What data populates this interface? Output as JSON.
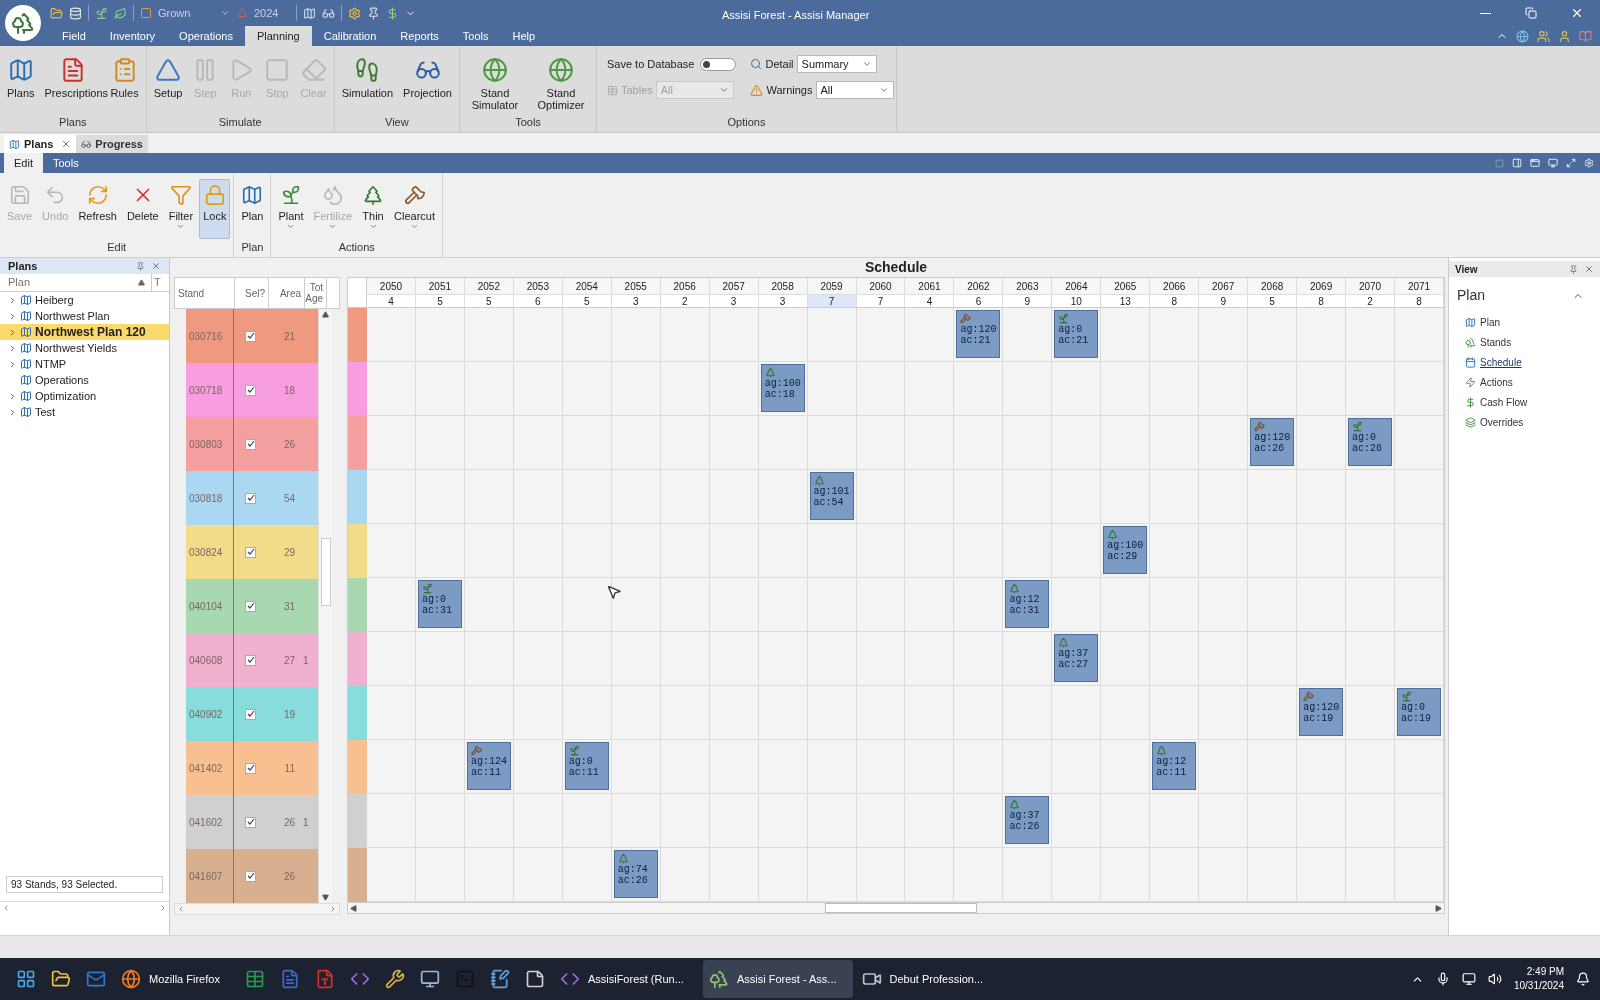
{
  "window": {
    "title": "Assisi Forest - Assisi Manager"
  },
  "quick_access": {
    "mode": "Grown",
    "year": "2024"
  },
  "menu_tabs": [
    {
      "label": "Field",
      "selected": false
    },
    {
      "label": "Inventory",
      "selected": false
    },
    {
      "label": "Operations",
      "selected": false
    },
    {
      "label": "Planning",
      "selected": true
    },
    {
      "label": "Calibration",
      "selected": false
    },
    {
      "label": "Reports",
      "selected": false
    },
    {
      "label": "Tools",
      "selected": false
    },
    {
      "label": "Help",
      "selected": false
    }
  ],
  "ribbon": [
    {
      "label": "Plans",
      "buttons": [
        {
          "kind": "plans",
          "label": "Plans",
          "disabled": false
        },
        {
          "kind": "prescriptions",
          "label": "Prescriptions",
          "disabled": false
        },
        {
          "kind": "rules",
          "label": "Rules",
          "disabled": false
        }
      ]
    },
    {
      "label": "Simulate",
      "buttons": [
        {
          "kind": "setup",
          "label": "Setup",
          "disabled": false
        },
        {
          "kind": "step",
          "label": "Step",
          "disabled": true
        },
        {
          "kind": "run",
          "label": "Run",
          "disabled": true
        },
        {
          "kind": "stop",
          "label": "Stop",
          "disabled": true
        },
        {
          "kind": "clear",
          "label": "Clear",
          "disabled": true
        }
      ]
    },
    {
      "label": "View",
      "buttons": [
        {
          "kind": "simulation",
          "label": "Simulation",
          "disabled": false
        },
        {
          "kind": "projection",
          "label": "Projection",
          "disabled": false
        }
      ]
    },
    {
      "label": "Tools",
      "buttons": [
        {
          "kind": "simulator",
          "label": "Stand Simulator",
          "disabled": false
        },
        {
          "kind": "optimizer",
          "label": "Stand Optimizer",
          "disabled": false
        }
      ]
    }
  ],
  "options": {
    "label": "Options",
    "save_label": "Save to Database",
    "save_on": false,
    "detail_label": "Detail",
    "detail_value": "Summary",
    "tables_label": "Tables",
    "tables_value": "All",
    "tables_disabled": true,
    "warnings_label": "Warnings",
    "warnings_value": "All"
  },
  "doc_tabs": [
    {
      "label": "Plans",
      "selected": true
    },
    {
      "label": "Progress",
      "selected": false
    }
  ],
  "sub_tabs": [
    {
      "label": "Edit",
      "selected": true
    },
    {
      "label": "Tools",
      "selected": false
    }
  ],
  "sub_ribbon": [
    {
      "label": "Edit",
      "buttons": [
        {
          "kind": "save",
          "label": "Save",
          "disabled": true,
          "has_menu": false,
          "pressed": false
        },
        {
          "kind": "undo",
          "label": "Undo",
          "disabled": true,
          "has_menu": false,
          "pressed": false
        },
        {
          "kind": "refresh",
          "label": "Refresh",
          "disabled": false,
          "has_menu": false,
          "pressed": false
        },
        {
          "kind": "delete",
          "label": "Delete",
          "disabled": false,
          "has_menu": false,
          "pressed": false
        },
        {
          "kind": "filter",
          "label": "Filter",
          "disabled": false,
          "has_menu": true,
          "pressed": false
        },
        {
          "kind": "lock",
          "label": "Lock",
          "disabled": false,
          "has_menu": false,
          "pressed": true
        }
      ]
    },
    {
      "label": "Plan",
      "buttons": [
        {
          "kind": "plan",
          "label": "Plan",
          "disabled": false,
          "has_menu": false,
          "pressed": false
        }
      ]
    },
    {
      "label": "Actions",
      "buttons": [
        {
          "kind": "plant",
          "label": "Plant",
          "disabled": false,
          "has_menu": true,
          "pressed": false
        },
        {
          "kind": "fertilize",
          "label": "Fertilize",
          "disabled": true,
          "has_menu": true,
          "pressed": false
        },
        {
          "kind": "thin",
          "label": "Thin",
          "disabled": false,
          "has_menu": true,
          "pressed": false
        },
        {
          "kind": "clearcut",
          "label": "Clearcut",
          "disabled": false,
          "has_menu": true,
          "pressed": false
        }
      ]
    }
  ],
  "plans_panel": {
    "title": "Plans",
    "column": "Plan",
    "column_2": "T",
    "status": "93 Stands, 93 Selected.",
    "items": [
      {
        "label": "Heiberg",
        "expandable": true,
        "selected": false
      },
      {
        "label": "Northwest Plan",
        "expandable": true,
        "selected": false
      },
      {
        "label": "Northwest Plan 120",
        "expandable": true,
        "selected": true
      },
      {
        "label": "Northwest Yields",
        "expandable": true,
        "selected": false
      },
      {
        "label": "NTMP",
        "expandable": true,
        "selected": false
      },
      {
        "label": "Operations",
        "expandable": false,
        "selected": false
      },
      {
        "label": "Optimization",
        "expandable": true,
        "selected": false
      },
      {
        "label": "Test",
        "expandable": true,
        "selected": false
      }
    ]
  },
  "stand_grid": {
    "columns": [
      "Stand",
      "Sel?",
      "Area",
      "Tot Age"
    ]
  },
  "schedule": {
    "title": "Schedule",
    "years": [
      {
        "year": "2050",
        "count": "4",
        "selected": false
      },
      {
        "year": "2051",
        "count": "5",
        "selected": false
      },
      {
        "year": "2052",
        "count": "5",
        "selected": false
      },
      {
        "year": "2053",
        "count": "6",
        "selected": false
      },
      {
        "year": "2054",
        "count": "5",
        "selected": false
      },
      {
        "year": "2055",
        "count": "3",
        "selected": false
      },
      {
        "year": "2056",
        "count": "2",
        "selected": false
      },
      {
        "year": "2057",
        "count": "3",
        "selected": false
      },
      {
        "year": "2058",
        "count": "3",
        "selected": false
      },
      {
        "year": "2059",
        "count": "7",
        "selected": true
      },
      {
        "year": "2060",
        "count": "7",
        "selected": false
      },
      {
        "year": "2061",
        "count": "4",
        "selected": false
      },
      {
        "year": "2062",
        "count": "6",
        "selected": false
      },
      {
        "year": "2063",
        "count": "9",
        "selected": false
      },
      {
        "year": "2064",
        "count": "10",
        "selected": false
      },
      {
        "year": "2065",
        "count": "13",
        "selected": false
      },
      {
        "year": "2066",
        "count": "8",
        "selected": false
      },
      {
        "year": "2067",
        "count": "9",
        "selected": false
      },
      {
        "year": "2068",
        "count": "5",
        "selected": false
      },
      {
        "year": "2069",
        "count": "8",
        "selected": false
      },
      {
        "year": "2070",
        "count": "2",
        "selected": false
      },
      {
        "year": "2071",
        "count": "8",
        "selected": false
      }
    ]
  },
  "stands": [
    {
      "stand": "030716",
      "checked": true,
      "area": "21",
      "color": "#ef9a80",
      "timeline": [
        {
          "kind": "empty"
        },
        {
          "kind": "empty"
        },
        {
          "kind": "empty"
        },
        {
          "kind": "empty"
        },
        {
          "kind": "empty"
        },
        {
          "kind": "empty"
        },
        {
          "kind": "empty"
        },
        {
          "kind": "empty"
        },
        {
          "kind": "empty"
        },
        {
          "kind": "empty"
        },
        {
          "kind": "empty"
        },
        {
          "kind": "empty"
        },
        {
          "kind": "clearcut",
          "ag": "ag:120",
          "ac": "ac:21"
        },
        {
          "kind": "empty"
        },
        {
          "kind": "plant",
          "ag": "ag:0",
          "ac": "ac:21"
        },
        {
          "kind": "empty"
        },
        {
          "kind": "empty"
        },
        {
          "kind": "empty"
        },
        {
          "kind": "empty"
        },
        {
          "kind": "empty"
        },
        {
          "kind": "empty"
        },
        {
          "kind": "empty"
        }
      ]
    },
    {
      "stand": "030718",
      "checked": true,
      "area": "18",
      "color": "#f79de0",
      "timeline": [
        {
          "kind": "empty"
        },
        {
          "kind": "empty"
        },
        {
          "kind": "empty"
        },
        {
          "kind": "empty"
        },
        {
          "kind": "empty"
        },
        {
          "kind": "empty"
        },
        {
          "kind": "empty"
        },
        {
          "kind": "empty"
        },
        {
          "kind": "thin",
          "ag": "ag:100",
          "ac": "ac:18"
        },
        {
          "kind": "empty"
        },
        {
          "kind": "empty"
        },
        {
          "kind": "empty"
        },
        {
          "kind": "empty"
        },
        {
          "kind": "empty"
        },
        {
          "kind": "empty"
        },
        {
          "kind": "empty"
        },
        {
          "kind": "empty"
        },
        {
          "kind": "empty"
        },
        {
          "kind": "empty"
        },
        {
          "kind": "empty"
        },
        {
          "kind": "empty"
        },
        {
          "kind": "empty"
        }
      ]
    },
    {
      "stand": "030803",
      "checked": true,
      "area": "26",
      "color": "#f4a0a0",
      "timeline": [
        {
          "kind": "empty"
        },
        {
          "kind": "empty"
        },
        {
          "kind": "empty"
        },
        {
          "kind": "empty"
        },
        {
          "kind": "empty"
        },
        {
          "kind": "empty"
        },
        {
          "kind": "empty"
        },
        {
          "kind": "empty"
        },
        {
          "kind": "empty"
        },
        {
          "kind": "empty"
        },
        {
          "kind": "empty"
        },
        {
          "kind": "empty"
        },
        {
          "kind": "empty"
        },
        {
          "kind": "empty"
        },
        {
          "kind": "empty"
        },
        {
          "kind": "empty"
        },
        {
          "kind": "empty"
        },
        {
          "kind": "empty"
        },
        {
          "kind": "clearcut",
          "ag": "ag:120",
          "ac": "ac:26"
        },
        {
          "kind": "empty"
        },
        {
          "kind": "plant",
          "ag": "ag:0",
          "ac": "ac:26"
        },
        {
          "kind": "empty"
        }
      ]
    },
    {
      "stand": "030818",
      "checked": true,
      "area": "54",
      "color": "#aad8f2",
      "timeline": [
        {
          "kind": "empty"
        },
        {
          "kind": "empty"
        },
        {
          "kind": "empty"
        },
        {
          "kind": "empty"
        },
        {
          "kind": "empty"
        },
        {
          "kind": "empty"
        },
        {
          "kind": "empty"
        },
        {
          "kind": "empty"
        },
        {
          "kind": "empty"
        },
        {
          "kind": "thin",
          "ag": "ag:101",
          "ac": "ac:54"
        },
        {
          "kind": "empty"
        },
        {
          "kind": "empty"
        },
        {
          "kind": "empty"
        },
        {
          "kind": "empty"
        },
        {
          "kind": "empty"
        },
        {
          "kind": "empty"
        },
        {
          "kind": "empty"
        },
        {
          "kind": "empty"
        },
        {
          "kind": "empty"
        },
        {
          "kind": "empty"
        },
        {
          "kind": "empty"
        },
        {
          "kind": "empty"
        }
      ]
    },
    {
      "stand": "030824",
      "checked": true,
      "area": "29",
      "color": "#f2dc8a",
      "timeline": [
        {
          "kind": "empty"
        },
        {
          "kind": "empty"
        },
        {
          "kind": "empty"
        },
        {
          "kind": "empty"
        },
        {
          "kind": "empty"
        },
        {
          "kind": "empty"
        },
        {
          "kind": "empty"
        },
        {
          "kind": "empty"
        },
        {
          "kind": "empty"
        },
        {
          "kind": "empty"
        },
        {
          "kind": "empty"
        },
        {
          "kind": "empty"
        },
        {
          "kind": "empty"
        },
        {
          "kind": "empty"
        },
        {
          "kind": "empty"
        },
        {
          "kind": "thin",
          "ag": "ag:100",
          "ac": "ac:29"
        },
        {
          "kind": "empty"
        },
        {
          "kind": "empty"
        },
        {
          "kind": "empty"
        },
        {
          "kind": "empty"
        },
        {
          "kind": "empty"
        },
        {
          "kind": "empty"
        }
      ]
    },
    {
      "stand": "040104",
      "checked": true,
      "area": "31",
      "color": "#a8d8b0",
      "timeline": [
        {
          "kind": "empty"
        },
        {
          "kind": "plant",
          "ag": "ag:0",
          "ac": "ac:31"
        },
        {
          "kind": "empty"
        },
        {
          "kind": "empty"
        },
        {
          "kind": "empty"
        },
        {
          "kind": "empty"
        },
        {
          "kind": "empty"
        },
        {
          "kind": "empty"
        },
        {
          "kind": "empty"
        },
        {
          "kind": "empty"
        },
        {
          "kind": "empty"
        },
        {
          "kind": "empty"
        },
        {
          "kind": "empty"
        },
        {
          "kind": "thin",
          "ag": "ag:12",
          "ac": "ac:31"
        },
        {
          "kind": "empty"
        },
        {
          "kind": "empty"
        },
        {
          "kind": "empty"
        },
        {
          "kind": "empty"
        },
        {
          "kind": "empty"
        },
        {
          "kind": "empty"
        },
        {
          "kind": "empty"
        },
        {
          "kind": "empty"
        }
      ]
    },
    {
      "stand": "040608",
      "checked": true,
      "area": "27",
      "tot_age": "1",
      "color": "#f0b0d0",
      "timeline": [
        {
          "kind": "empty"
        },
        {
          "kind": "empty"
        },
        {
          "kind": "empty"
        },
        {
          "kind": "empty"
        },
        {
          "kind": "empty"
        },
        {
          "kind": "empty"
        },
        {
          "kind": "empty"
        },
        {
          "kind": "empty"
        },
        {
          "kind": "empty"
        },
        {
          "kind": "empty"
        },
        {
          "kind": "empty"
        },
        {
          "kind": "empty"
        },
        {
          "kind": "empty"
        },
        {
          "kind": "empty"
        },
        {
          "kind": "thin",
          "ag": "ag:37",
          "ac": "ac:27"
        },
        {
          "kind": "empty"
        },
        {
          "kind": "empty"
        },
        {
          "kind": "empty"
        },
        {
          "kind": "empty"
        },
        {
          "kind": "empty"
        },
        {
          "kind": "empty"
        },
        {
          "kind": "empty"
        }
      ]
    },
    {
      "stand": "040902",
      "checked": true,
      "area": "19",
      "color": "#88dcdc",
      "timeline": [
        {
          "kind": "empty"
        },
        {
          "kind": "empty"
        },
        {
          "kind": "empty"
        },
        {
          "kind": "empty"
        },
        {
          "kind": "empty"
        },
        {
          "kind": "empty"
        },
        {
          "kind": "empty"
        },
        {
          "kind": "empty"
        },
        {
          "kind": "empty"
        },
        {
          "kind": "empty"
        },
        {
          "kind": "empty"
        },
        {
          "kind": "empty"
        },
        {
          "kind": "empty"
        },
        {
          "kind": "empty"
        },
        {
          "kind": "empty"
        },
        {
          "kind": "empty"
        },
        {
          "kind": "empty"
        },
        {
          "kind": "empty"
        },
        {
          "kind": "empty"
        },
        {
          "kind": "clearcut",
          "ag": "ag:120",
          "ac": "ac:19"
        },
        {
          "kind": "empty"
        },
        {
          "kind": "plant",
          "ag": "ag:0",
          "ac": "ac:19"
        }
      ]
    },
    {
      "stand": "041402",
      "checked": true,
      "area": "11",
      "color": "#f8c090",
      "timeline": [
        {
          "kind": "empty"
        },
        {
          "kind": "empty"
        },
        {
          "kind": "clearcut",
          "ag": "ag:124",
          "ac": "ac:11"
        },
        {
          "kind": "empty"
        },
        {
          "kind": "plant",
          "ag": "ag:0",
          "ac": "ac:11"
        },
        {
          "kind": "empty"
        },
        {
          "kind": "empty"
        },
        {
          "kind": "empty"
        },
        {
          "kind": "empty"
        },
        {
          "kind": "empty"
        },
        {
          "kind": "empty"
        },
        {
          "kind": "empty"
        },
        {
          "kind": "empty"
        },
        {
          "kind": "empty"
        },
        {
          "kind": "empty"
        },
        {
          "kind": "empty"
        },
        {
          "kind": "thin",
          "ag": "ag:12",
          "ac": "ac:11"
        },
        {
          "kind": "empty"
        },
        {
          "kind": "empty"
        },
        {
          "kind": "empty"
        },
        {
          "kind": "empty"
        },
        {
          "kind": "empty"
        }
      ]
    },
    {
      "stand": "041602",
      "checked": true,
      "area": "26",
      "tot_age": "1",
      "color": "#d0d0d0",
      "timeline": [
        {
          "kind": "empty"
        },
        {
          "kind": "empty"
        },
        {
          "kind": "empty"
        },
        {
          "kind": "empty"
        },
        {
          "kind": "empty"
        },
        {
          "kind": "empty"
        },
        {
          "kind": "empty"
        },
        {
          "kind": "empty"
        },
        {
          "kind": "empty"
        },
        {
          "kind": "empty"
        },
        {
          "kind": "empty"
        },
        {
          "kind": "empty"
        },
        {
          "kind": "empty"
        },
        {
          "kind": "thin",
          "ag": "ag:37",
          "ac": "ac:26"
        },
        {
          "kind": "empty"
        },
        {
          "kind": "empty"
        },
        {
          "kind": "empty"
        },
        {
          "kind": "empty"
        },
        {
          "kind": "empty"
        },
        {
          "kind": "empty"
        },
        {
          "kind": "empty"
        },
        {
          "kind": "empty"
        }
      ]
    },
    {
      "stand": "041607",
      "checked": true,
      "area": "26",
      "color": "#d8b090",
      "timeline": [
        {
          "kind": "empty"
        },
        {
          "kind": "empty"
        },
        {
          "kind": "empty"
        },
        {
          "kind": "empty"
        },
        {
          "kind": "empty"
        },
        {
          "kind": "thin",
          "ag": "ag:74",
          "ac": "ac:26"
        },
        {
          "kind": "empty"
        },
        {
          "kind": "empty"
        },
        {
          "kind": "empty"
        },
        {
          "kind": "empty"
        },
        {
          "kind": "empty"
        },
        {
          "kind": "empty"
        },
        {
          "kind": "empty"
        },
        {
          "kind": "empty"
        },
        {
          "kind": "empty"
        },
        {
          "kind": "empty"
        },
        {
          "kind": "empty"
        },
        {
          "kind": "empty"
        },
        {
          "kind": "empty"
        },
        {
          "kind": "empty"
        },
        {
          "kind": "empty"
        },
        {
          "kind": "empty"
        }
      ]
    }
  ],
  "view_panel": {
    "title": "View",
    "section": "Plan",
    "items": [
      {
        "kind": "plan",
        "label": "Plan",
        "selected": false
      },
      {
        "kind": "stands",
        "label": "Stands",
        "selected": false
      },
      {
        "kind": "schedule",
        "label": "Schedule",
        "selected": true
      },
      {
        "kind": "actions",
        "label": "Actions",
        "selected": false
      },
      {
        "kind": "cashflow",
        "label": "Cash Flow",
        "selected": false
      },
      {
        "kind": "overrides",
        "label": "Overrides",
        "selected": false
      }
    ]
  },
  "taskbar": {
    "apps": [
      {
        "kind": "start",
        "selected": false
      },
      {
        "kind": "folder",
        "selected": false
      },
      {
        "kind": "mail",
        "selected": false
      },
      {
        "kind": "browser",
        "label": "Mozilla Firefox",
        "selected": false
      },
      {
        "kind": "sheet",
        "selected": false
      },
      {
        "kind": "doc",
        "selected": false
      },
      {
        "kind": "pdf",
        "selected": false
      },
      {
        "kind": "studio",
        "selected": false
      },
      {
        "kind": "tool",
        "selected": false
      },
      {
        "kind": "screen",
        "selected": false
      },
      {
        "kind": "terminal",
        "selected": false
      },
      {
        "kind": "notepad",
        "selected": false
      },
      {
        "kind": "notes",
        "selected": false
      },
      {
        "kind": "studio",
        "label": "AssisiForest (Run...",
        "selected": false
      },
      {
        "kind": "app",
        "label": "Assisi Forest - Ass...",
        "selected": true
      },
      {
        "kind": "recorder",
        "label": "Debut Profession...",
        "selected": false
      }
    ],
    "time": "2:49 PM",
    "date": "10/31/2024"
  }
}
